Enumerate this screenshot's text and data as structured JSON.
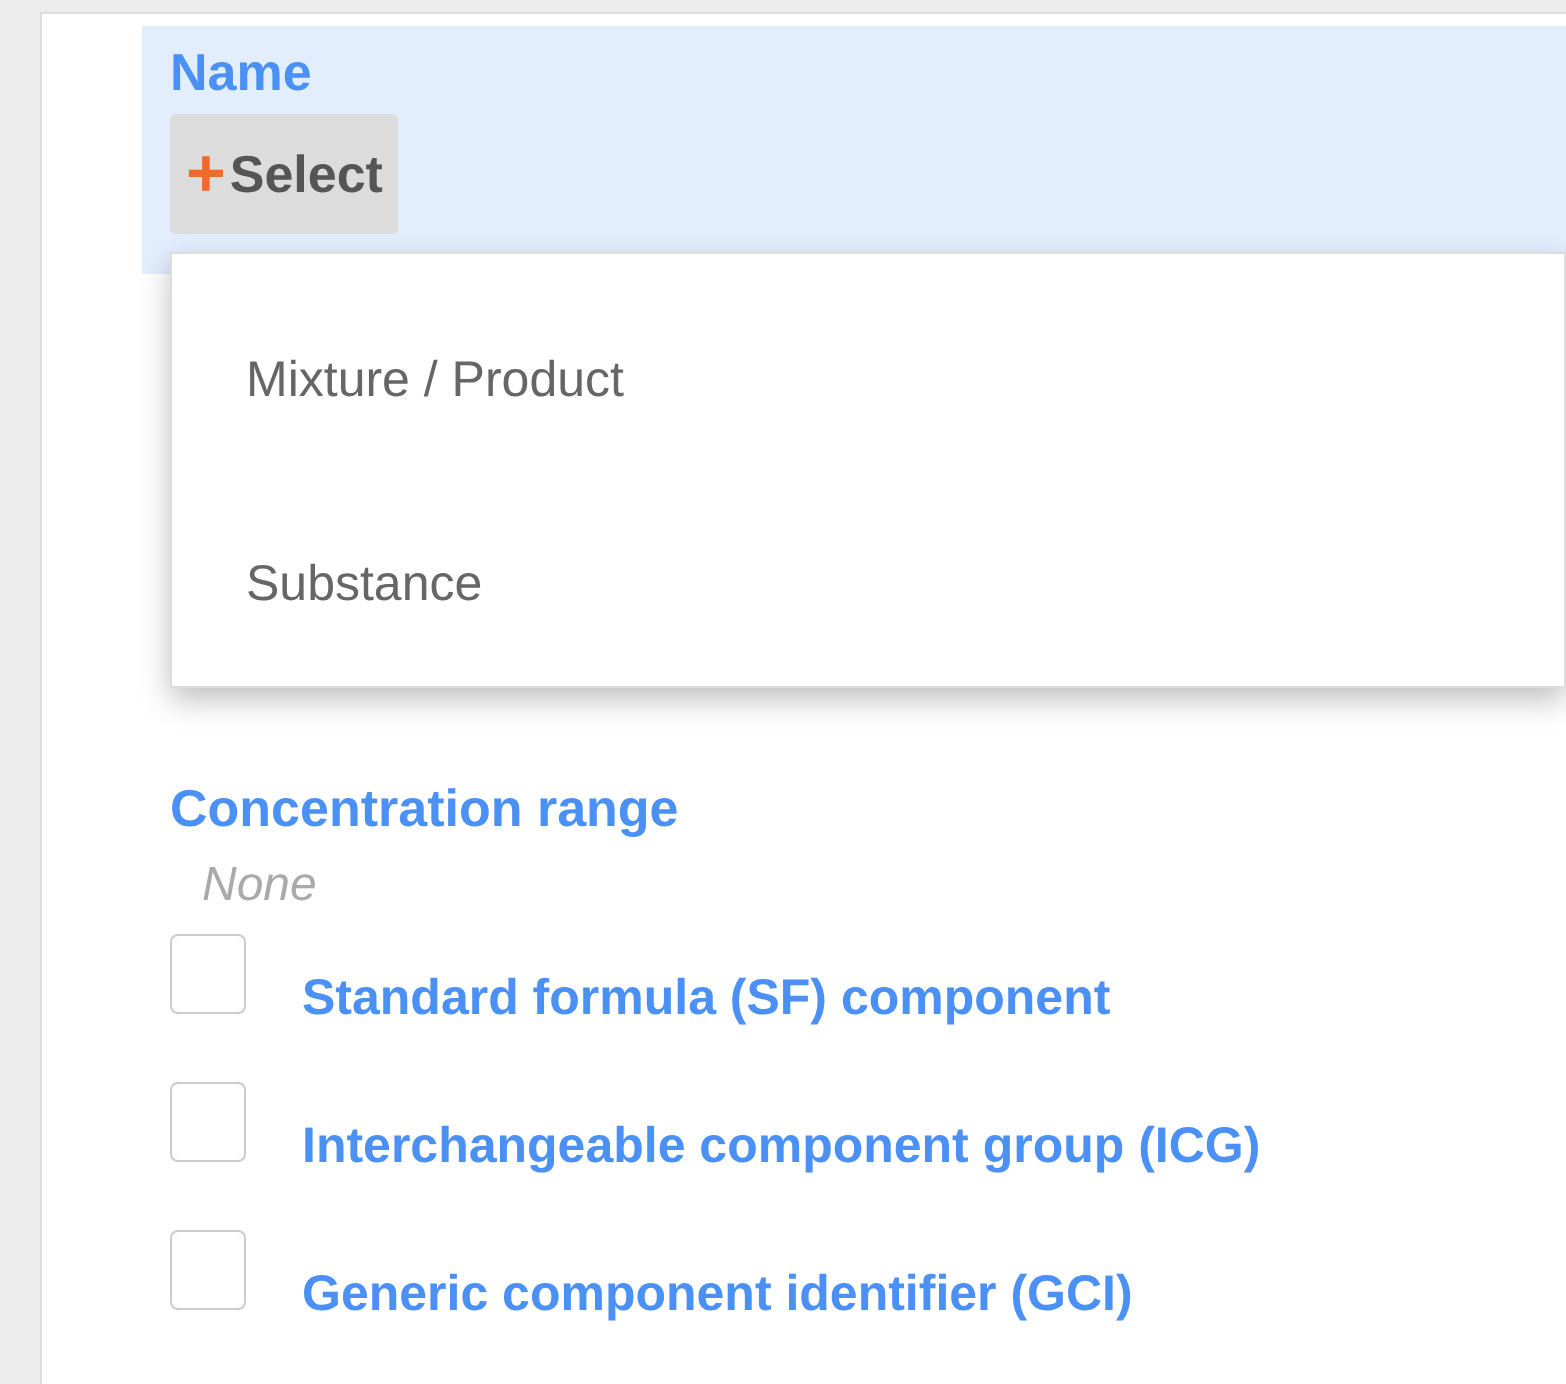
{
  "name_field": {
    "label": "Name",
    "button": {
      "icon": "+",
      "label": "Select"
    }
  },
  "menu": {
    "items": [
      {
        "label": "Mixture / Product"
      },
      {
        "label": "Substance"
      }
    ]
  },
  "concentration_range": {
    "label": "Concentration range",
    "value": "None"
  },
  "checkboxes": [
    {
      "label": "Standard formula (SF) component",
      "checked": false
    },
    {
      "label": "Interchangeable component group (ICG)",
      "checked": false
    },
    {
      "label": "Generic component identifier (GCI)",
      "checked": false
    }
  ]
}
